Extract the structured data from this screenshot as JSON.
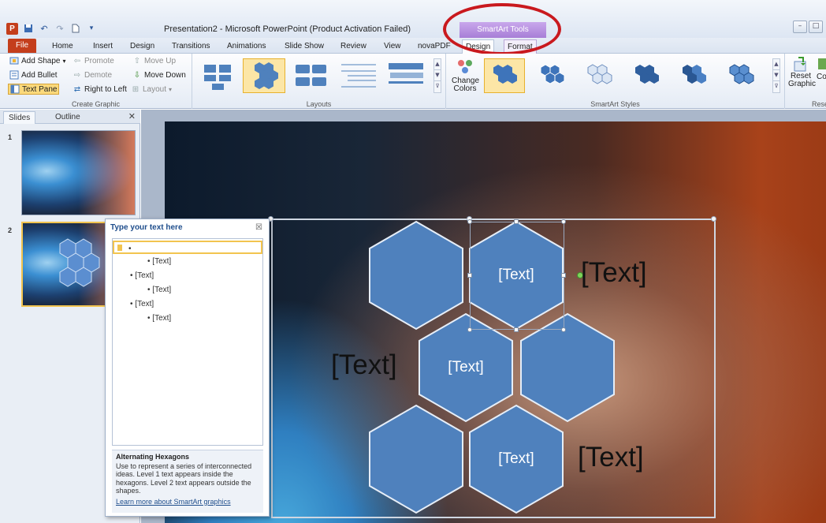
{
  "titlebar": {
    "title": "Presentation2 - Microsoft PowerPoint (Product Activation Failed)",
    "contextual_group": "SmartArt Tools"
  },
  "tabs": [
    "File",
    "Home",
    "Insert",
    "Design",
    "Transitions",
    "Animations",
    "Slide Show",
    "Review",
    "View",
    "novaPDF"
  ],
  "context_tabs": [
    "Design",
    "Format"
  ],
  "ribbon": {
    "create_graphic": {
      "label": "Create Graphic",
      "add_shape": "Add Shape",
      "add_bullet": "Add Bullet",
      "text_pane": "Text Pane",
      "promote": "Promote",
      "demote": "Demote",
      "right_to_left": "Right to Left",
      "move_up": "Move Up",
      "move_down": "Move Down",
      "layout": "Layout"
    },
    "layouts": {
      "label": "Layouts"
    },
    "change_colors": "Change Colors",
    "smartart_styles": {
      "label": "SmartArt Styles"
    },
    "reset": {
      "label": "Reset",
      "reset_graphic": "Reset Graphic",
      "convert_partial": "Co"
    }
  },
  "slides_panel": {
    "tabs": [
      "Slides",
      "Outline"
    ],
    "slide_numbers": [
      "1",
      "2"
    ]
  },
  "text_pane": {
    "title": "Type your text here",
    "close_glyph": "☒",
    "lines": [
      {
        "level": 1,
        "text": ""
      },
      {
        "level": 2,
        "text": "[Text]"
      },
      {
        "level": 1,
        "text": "[Text]"
      },
      {
        "level": 2,
        "text": "[Text]"
      },
      {
        "level": 1,
        "text": "[Text]"
      },
      {
        "level": 2,
        "text": "[Text]"
      }
    ],
    "description_title": "Alternating Hexagons",
    "description": "Use to represent a series of interconnected ideas. Level 1 text appears inside the hexagons. Level 2 text appears outside the shapes.",
    "link": "Learn more about SmartArt graphics"
  },
  "smartart": {
    "hex_labels": [
      "",
      "[Text]",
      "[Text]",
      "",
      "",
      "[Text]"
    ],
    "outer_labels": [
      "[Text]",
      "[Text]",
      "[Text]"
    ]
  },
  "colors": {
    "file_tab": "#c43e1c",
    "hex_fill": "#4f81bd",
    "annotation_oval": "#c9191e",
    "contextual_tab": "#a77ed6"
  }
}
